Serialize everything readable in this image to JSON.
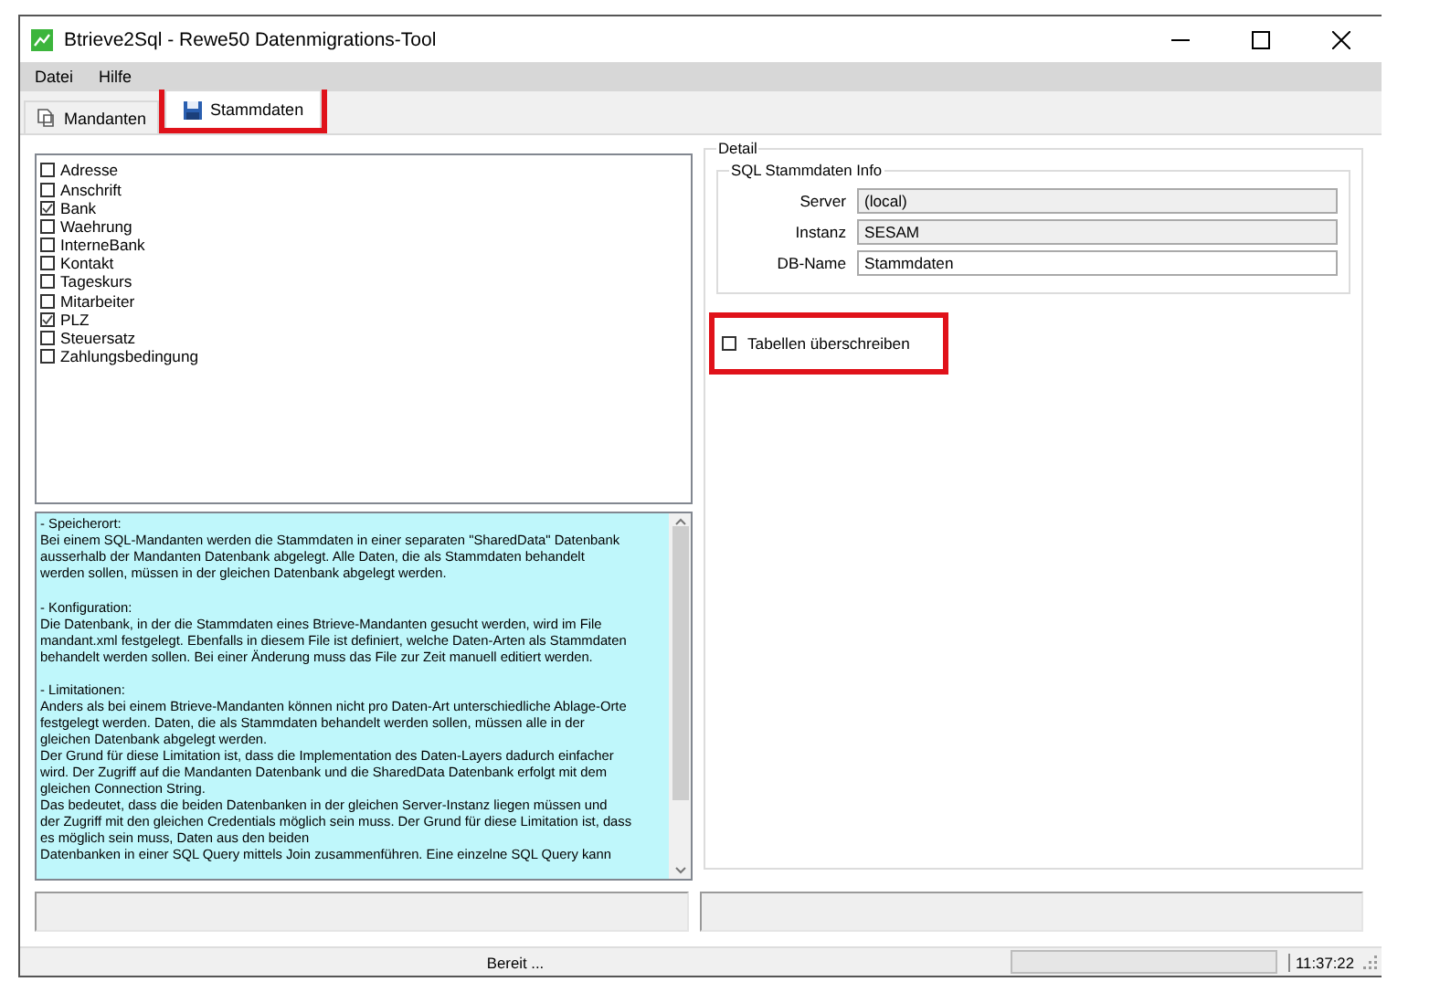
{
  "window": {
    "title": "Btrieve2Sql - Rewe50 Datenmigrations-Tool"
  },
  "menu": [
    "Datei",
    "Hilfe"
  ],
  "tabs": [
    {
      "label": "Mandanten",
      "selected": false
    },
    {
      "label": "Stammdaten",
      "selected": true
    }
  ],
  "tables": [
    {
      "label": "Adresse",
      "checked": false
    },
    {
      "label": "Anschrift",
      "checked": false
    },
    {
      "label": "Bank",
      "checked": true
    },
    {
      "label": "Waehrung",
      "checked": false
    },
    {
      "label": "InterneBank",
      "checked": false
    },
    {
      "label": "Kontakt",
      "checked": false
    },
    {
      "label": "Tageskurs",
      "checked": false
    },
    {
      "label": "Mitarbeiter",
      "checked": false
    },
    {
      "label": "PLZ",
      "checked": true
    },
    {
      "label": "Steuersatz",
      "checked": false
    },
    {
      "label": "Zahlungsbedingung",
      "checked": false
    }
  ],
  "info_blocks": [
    [
      "- Speicherort:",
      "Bei einem SQL-Mandanten werden die Stammdaten in einer separaten \"SharedData\" Datenbank",
      "ausserhalb der Mandanten Datenbank abgelegt. Alle Daten, die als Stammdaten behandelt",
      "werden sollen, müssen in der gleichen Datenbank abgelegt werden."
    ],
    [
      "- Konfiguration:",
      "Die Datenbank, in der die Stammdaten eines Btrieve-Mandanten gesucht werden, wird im File",
      "mandant.xml festgelegt. Ebenfalls in diesem File ist definiert, welche Daten-Arten als Stammdaten",
      "behandelt werden sollen. Bei einer Änderung muss das File zur Zeit manuell editiert werden."
    ],
    [
      "- Limitationen:",
      "Anders als bei einem Btrieve-Mandanten können nicht pro Daten-Art unterschiedliche Ablage-Orte",
      "festgelegt werden. Daten, die als Stammdaten behandelt werden sollen, müssen alle in der",
      "gleichen Datenbank abgelegt werden.",
      "Der Grund für diese Limitation ist, dass die Implementation des Daten-Layers dadurch einfacher",
      "wird. Der Zugriff auf die Mandanten Datenbank und die SharedData Datenbank erfolgt mit dem",
      "gleichen Connection String.",
      "Das bedeutet, dass die beiden Datenbanken in der gleichen Server-Instanz liegen müssen und",
      "der Zugriff mit den gleichen Credentials möglich sein muss. Der Grund für diese Limitation ist, dass",
      "es möglich sein muss, Daten aus den beiden",
      "Datenbanken in einer SQL Query mittels Join zusammenführen. Eine einzelne SQL Query kann"
    ]
  ],
  "detail": {
    "title": "Detail",
    "group_title": "SQL Stammdaten Info",
    "fields": [
      {
        "label": "Server",
        "value": "(local)",
        "disabled": true
      },
      {
        "label": "Instanz",
        "value": "SESAM",
        "disabled": true
      },
      {
        "label": "DB-Name",
        "value": "Stammdaten",
        "disabled": false
      }
    ],
    "overwrite": {
      "label": "Tabellen überschreiben",
      "checked": false
    }
  },
  "status_bar": {
    "text": "Bereit ...",
    "progress": {
      "level": 0
    },
    "time": "11:37:22"
  }
}
